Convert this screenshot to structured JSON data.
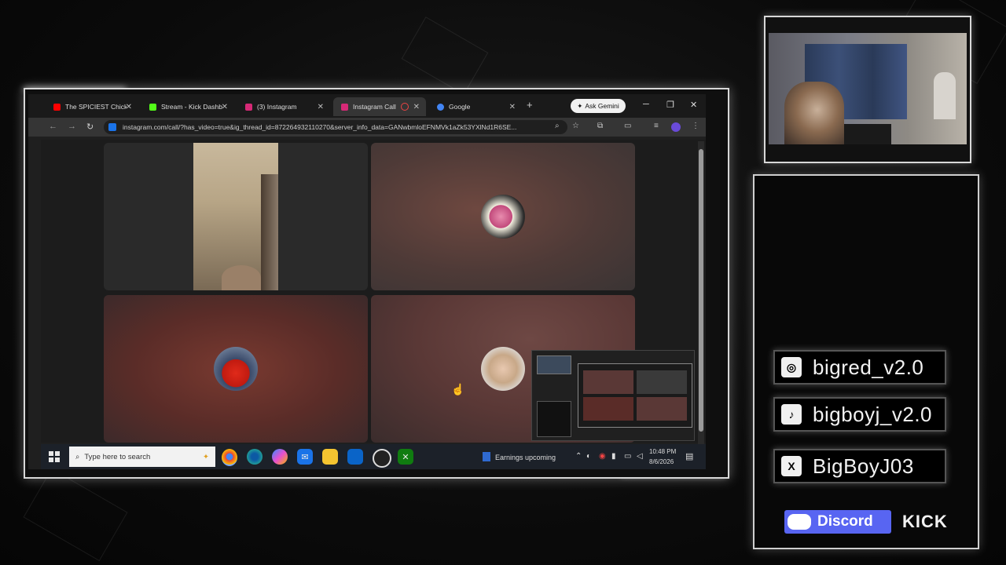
{
  "browser": {
    "tabs": [
      {
        "label": "The SPICIEST Chicken",
        "color": "#ff0000"
      },
      {
        "label": "Stream - Kick Dashboard",
        "color": "#53fc18"
      },
      {
        "label": "(3) Instagram",
        "color": "#d62976"
      },
      {
        "label": "Instagram Call",
        "color": "#d62976"
      },
      {
        "label": "Google",
        "color": "#4285f4"
      }
    ],
    "new_tab": "+",
    "ask_gemini": "Ask Gemini",
    "url": "instagram.com/call/?has_video=true&ig_thread_id=872264932110270&server_info_data=GANwbmloEFNMVk1aZk53YXlNd1R6SE..."
  },
  "taskbar": {
    "search_placeholder": "Type here to search",
    "news": "Earnings upcoming",
    "time": "10:48 PM",
    "date": "8/6/2026"
  },
  "socials": {
    "instagram": "bigred_v2.0",
    "tiktok": "bigboyj_v2.0",
    "x": "BigBoyJ03",
    "discord": "Discord",
    "kick": "KICK"
  }
}
